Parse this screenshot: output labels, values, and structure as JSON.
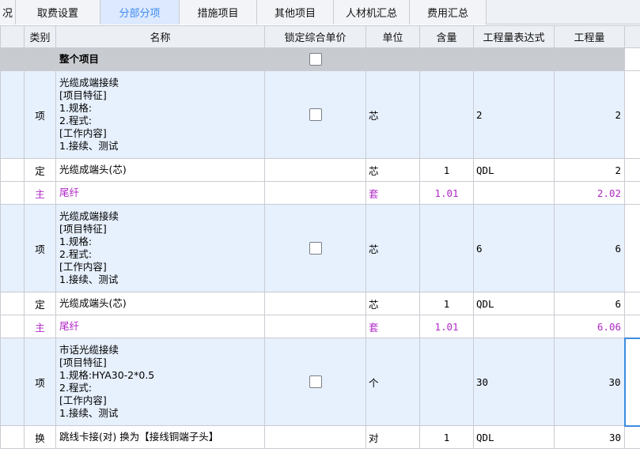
{
  "tabs": [
    {
      "id": "tab-partial",
      "label": "况",
      "active": false
    },
    {
      "id": "tab-fee-settings",
      "label": "取费设置",
      "active": false
    },
    {
      "id": "tab-sections",
      "label": "分部分项",
      "active": true
    },
    {
      "id": "tab-measures",
      "label": "措施项目",
      "active": false
    },
    {
      "id": "tab-other",
      "label": "其他项目",
      "active": false
    },
    {
      "id": "tab-labor-material",
      "label": "人材机汇总",
      "active": false
    },
    {
      "id": "tab-cost-summary",
      "label": "费用汇总",
      "active": false
    }
  ],
  "columns": {
    "category": "类别",
    "name": "名称",
    "lock_price": "锁定综合单价",
    "unit": "单位",
    "content": "含量",
    "expression": "工程量表达式",
    "quantity": "工程量"
  },
  "rows": [
    {
      "type": "root",
      "category": "",
      "name": [
        "整个项目"
      ],
      "checkbox": true,
      "unit": "",
      "content": "",
      "expression": "",
      "quantity": ""
    },
    {
      "type": "item",
      "category": "项",
      "name": [
        "光缆成端接续",
        "[项目特征]",
        "1.规格:",
        "2.程式:",
        "[工作内容]",
        "1.接续、测试"
      ],
      "checkbox": true,
      "unit": "芯",
      "content": "",
      "expression": "2",
      "quantity": "2"
    },
    {
      "type": "ding",
      "category": "定",
      "name": [
        "光缆成端头(芯)"
      ],
      "checkbox": false,
      "unit": "芯",
      "content": "1",
      "expression": "QDL",
      "quantity": "2"
    },
    {
      "type": "main",
      "category": "主",
      "name": [
        "尾纤"
      ],
      "checkbox": false,
      "unit": "套",
      "content": "1.01",
      "expression": "",
      "quantity": "2.02"
    },
    {
      "type": "item",
      "category": "项",
      "name": [
        "光缆成端接续",
        "[项目特征]",
        "1.规格:",
        "2.程式:",
        "[工作内容]",
        "1.接续、测试"
      ],
      "checkbox": true,
      "unit": "芯",
      "content": "",
      "expression": "6",
      "quantity": "6"
    },
    {
      "type": "ding",
      "category": "定",
      "name": [
        "光缆成端头(芯)"
      ],
      "checkbox": false,
      "unit": "芯",
      "content": "1",
      "expression": "QDL",
      "quantity": "6"
    },
    {
      "type": "main",
      "category": "主",
      "name": [
        "尾纤"
      ],
      "checkbox": false,
      "unit": "套",
      "content": "1.01",
      "expression": "",
      "quantity": "6.06"
    },
    {
      "type": "item",
      "category": "项",
      "name": [
        "市话光缆接续",
        "[项目特征]",
        "1.规格:HYA30-2*0.5",
        "2.程式:",
        "[工作内容]",
        "1.接续、测试"
      ],
      "checkbox": true,
      "unit": "个",
      "content": "",
      "expression": "30",
      "quantity": "30"
    },
    {
      "type": "huan",
      "category": "换",
      "name": [
        "跳线卡接(对)  换为【接线铜端子头】"
      ],
      "checkbox": false,
      "unit": "对",
      "content": "1",
      "expression": "QDL",
      "quantity": "30"
    }
  ],
  "colors": {
    "accent": "#3f8cf0",
    "item_row_bg": "#e7f0fd",
    "root_row_bg": "#c8cbd0",
    "main_material_text": "#b129c7"
  }
}
